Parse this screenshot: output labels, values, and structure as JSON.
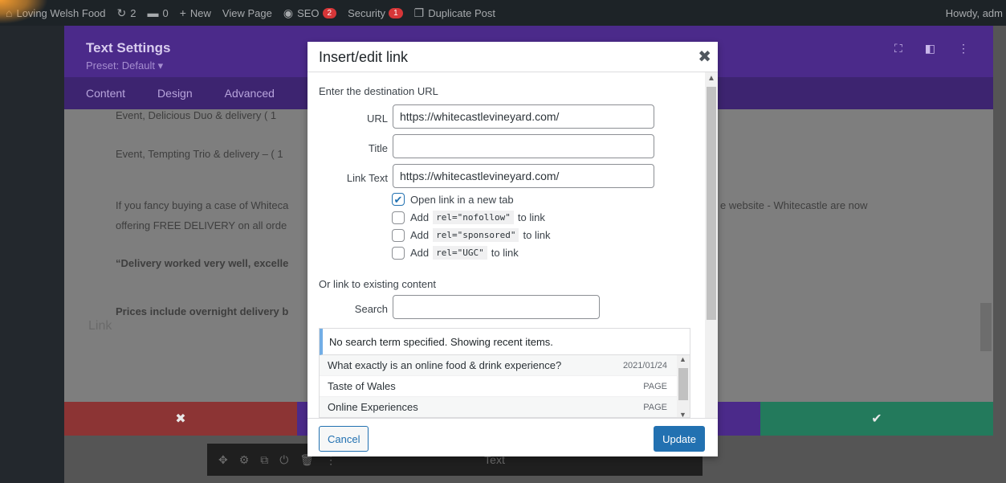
{
  "adminbar": {
    "site_name": "Loving Welsh Food",
    "updates_count": "2",
    "comments_count": "0",
    "new_label": "New",
    "view_page_label": "View Page",
    "seo_label": "SEO",
    "seo_badge": "2",
    "security_label": "Security",
    "security_badge": "1",
    "duplicate_label": "Duplicate Post",
    "howdy": "Howdy, adm"
  },
  "panel": {
    "title": "Text Settings",
    "preset": "Preset: Default ▾",
    "tabs": [
      "Content",
      "Design",
      "Advanced"
    ],
    "body_lines": [
      "Event, Delicious Duo & delivery ( 1",
      "Event, Tempting Trio & delivery – ( 1",
      "If you fancy buying a case of Whiteca",
      "e website -  Whitecastle are now",
      "offering FREE DELIVERY on all orde",
      "“Delivery worked very well, excelle",
      "Prices include overnight delivery b"
    ],
    "link_section": "Link",
    "bottom_text": "Text"
  },
  "dialog": {
    "title": "Insert/edit link",
    "intro": "Enter the destination URL",
    "url_label": "URL",
    "url_value": "https://whitecastlevineyard.com/",
    "title_label": "Title",
    "title_value": "",
    "link_text_label": "Link Text",
    "link_text_value": "https://whitecastlevineyard.com/",
    "options": [
      {
        "prefix": "Open link in a new tab",
        "code": "",
        "suffix": "",
        "checked": true
      },
      {
        "prefix": "Add",
        "code": "rel=\"nofollow\"",
        "suffix": "to link",
        "checked": false
      },
      {
        "prefix": "Add",
        "code": "rel=\"sponsored\"",
        "suffix": "to link",
        "checked": false
      },
      {
        "prefix": "Add",
        "code": "rel=\"UGC\"",
        "suffix": "to link",
        "checked": false
      }
    ],
    "existing_label": "Or link to existing content",
    "search_label": "Search",
    "search_value": "",
    "notice": "No search term specified. Showing recent items.",
    "results": [
      {
        "title": "What exactly is an online food & drink experience?",
        "meta": "2021/01/24"
      },
      {
        "title": "Taste of Wales",
        "meta": "PAGE"
      },
      {
        "title": "Online Experiences",
        "meta": "PAGE"
      }
    ],
    "cancel_label": "Cancel",
    "update_label": "Update"
  },
  "colors": {
    "panel_header": "#4b2a8a",
    "primary_button": "#2271b1",
    "cancel_bar": "#8c3434",
    "save_bar": "#237a5c"
  }
}
